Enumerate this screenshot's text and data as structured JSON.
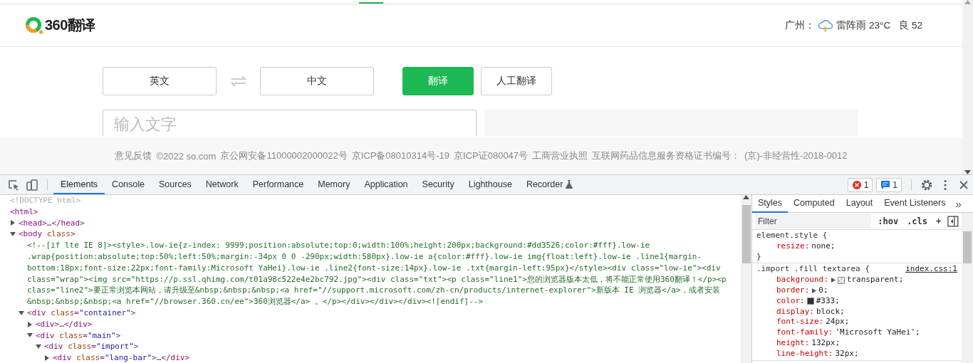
{
  "page": {
    "logo": {
      "text": "360翻译"
    },
    "weather": {
      "city": "广州：",
      "condition": "雷阵雨 23°C",
      "air_quality": "良 52"
    },
    "source_language": "英文",
    "target_language": "中文",
    "buttons": [
      {
        "label": "翻译",
        "kind": "primary"
      },
      {
        "label": "人工翻译",
        "kind": "secondary"
      }
    ],
    "input": {
      "placeholder": "输入文字"
    },
    "footer": [
      "意见反馈",
      "©2022 so.com",
      "京公网安备11000002000022号",
      "京ICP备08010314号-19",
      "京ICP证080047号",
      "工商营业执照",
      "互联网药品信息服务资格证书编号：",
      "(京)-非经营性-2018-0012"
    ]
  },
  "devtools": {
    "tabs": [
      {
        "label": "Elements",
        "selected": true,
        "kind": "plain"
      },
      {
        "label": "Console",
        "selected": false,
        "kind": "plain"
      },
      {
        "label": "Sources",
        "selected": false,
        "kind": "plain"
      },
      {
        "label": "Network",
        "selected": false,
        "kind": "plain"
      },
      {
        "label": "Performance",
        "selected": false,
        "kind": "plain"
      },
      {
        "label": "Memory",
        "selected": false,
        "kind": "plain"
      },
      {
        "label": "Application",
        "selected": false,
        "kind": "plain"
      },
      {
        "label": "Security",
        "selected": false,
        "kind": "plain"
      },
      {
        "label": "Lighthouse",
        "selected": false,
        "kind": "plain"
      },
      {
        "label": "Recorder",
        "selected": false,
        "kind": "experimental"
      }
    ],
    "badges": [
      {
        "kind": "error",
        "count": "1"
      },
      {
        "kind": "message",
        "count": "1"
      }
    ],
    "dom_tree": [
      {
        "kind": "doctype",
        "segments": [
          {
            "kind": "doctype",
            "text": "<!DOCTYPE html>"
          }
        ]
      },
      {
        "kind": "root",
        "segments": [
          {
            "kind": "tag",
            "text": "<html>"
          }
        ],
        "children": [
          {
            "kind": "node",
            "expanded": false,
            "segments": [
              {
                "kind": "tag",
                "text": "<head>"
              },
              {
                "kind": "text",
                "text": "…"
              },
              {
                "kind": "tag",
                "text": "</head>"
              }
            ]
          },
          {
            "kind": "node",
            "expanded": true,
            "segments": [
              {
                "kind": "tag",
                "text": "<body "
              },
              {
                "kind": "attr",
                "text": "class"
              },
              {
                "kind": "tag",
                "text": ">"
              }
            ],
            "children": [
              {
                "kind": "comment",
                "segments": [
                  {
                    "kind": "comment",
                    "text": "<!--[if lte IE 8]><style>.low-ie{z-index: 9999;position:absolute;top:0;width:100%;height:200px;background:#dd3526;color:#fff}.low-ie .wrap{position:absolute;top:50%;left:50%;margin:-34px 0 0 -290px;width:580px}.low-ie a{color:#fff}.low-ie img{float:left}.low-ie .line1{margin-bottom:18px;font-size:22px;font-family:Microsoft YaHei}.low-ie .line2{font-size:14px}.low-ie .txt{margin-left:95px}</style><div class=\"low-ie\"><div class=\"wrap\"><img src=\"https://p.ssl.qhimg.com/t01a98c522e4e2bc792.jpg\"><div class=\"txt\"><p class=\"line1\">您的浏览器版本太低，将不能正常使用360翻译！</p><p class=\"line2\">要正常浏览本网站，请升级至&nbsp;&nbsp;&nbsp;<a href=\"//support.microsoft.com/zh-cn/products/internet-explorer\">新版本 IE 浏览器</a>，或者安装&nbsp;&nbsp;&nbsp;<a href=\"//browser.360.cn/ee\">360浏览器</a> 。</p></div></div></div><![endif]-->"
                  }
                ]
              },
              {
                "kind": "node",
                "expanded": true,
                "segments": [
                  {
                    "kind": "tag",
                    "text": "<div "
                  },
                  {
                    "kind": "attr",
                    "text": "class"
                  },
                  {
                    "kind": "tag",
                    "text": "="
                  },
                  {
                    "kind": "value",
                    "text": "\"container\""
                  },
                  {
                    "kind": "tag",
                    "text": ">"
                  }
                ],
                "children": [
                  {
                    "kind": "node",
                    "expanded": false,
                    "segments": [
                      {
                        "kind": "tag",
                        "text": "<div>"
                      },
                      {
                        "kind": "text",
                        "text": "…"
                      },
                      {
                        "kind": "tag",
                        "text": "</div>"
                      }
                    ]
                  },
                  {
                    "kind": "node",
                    "expanded": true,
                    "segments": [
                      {
                        "kind": "tag",
                        "text": "<div "
                      },
                      {
                        "kind": "attr",
                        "text": "class"
                      },
                      {
                        "kind": "tag",
                        "text": "="
                      },
                      {
                        "kind": "value",
                        "text": "\"main\""
                      },
                      {
                        "kind": "tag",
                        "text": ">"
                      }
                    ],
                    "children": [
                      {
                        "kind": "node",
                        "expanded": true,
                        "segments": [
                          {
                            "kind": "tag",
                            "text": "<div "
                          },
                          {
                            "kind": "attr",
                            "text": "class"
                          },
                          {
                            "kind": "tag",
                            "text": "="
                          },
                          {
                            "kind": "value",
                            "text": "\"import\""
                          },
                          {
                            "kind": "tag",
                            "text": ">"
                          }
                        ],
                        "children": [
                          {
                            "kind": "node",
                            "expanded": false,
                            "segments": [
                              {
                                "kind": "tag",
                                "text": "<div "
                              },
                              {
                                "kind": "attr",
                                "text": "class"
                              },
                              {
                                "kind": "tag",
                                "text": "="
                              },
                              {
                                "kind": "value",
                                "text": "\"lang-bar\""
                              },
                              {
                                "kind": "tag",
                                "text": ">"
                              },
                              {
                                "kind": "text",
                                "text": "…"
                              },
                              {
                                "kind": "tag",
                                "text": "</div>"
                              }
                            ]
                          }
                        ]
                      }
                    ]
                  }
                ]
              }
            ]
          }
        ]
      }
    ],
    "styles_tabs": [
      {
        "label": "Styles",
        "selected": true
      },
      {
        "label": "Computed",
        "selected": false
      },
      {
        "label": "Layout",
        "selected": false
      },
      {
        "label": "Event Listeners",
        "selected": false
      }
    ],
    "more": "»",
    "filter": {
      "placeholder": "Filter"
    },
    "filter_buttons": [
      ":hov",
      ".cls",
      "+"
    ],
    "rules": [
      {
        "selector": "element.style {",
        "close": "}",
        "declarations": [
          {
            "property": "resize:",
            "value": "none;",
            "kind": "plain"
          }
        ]
      },
      {
        "selector": ".import .fill textarea {",
        "source": "index.css:1",
        "declarations": [
          {
            "property": "background:",
            "value": "transparent;",
            "kind": "transparent"
          },
          {
            "property": "border:",
            "value": "0;",
            "kind": "expandable"
          },
          {
            "property": "color:",
            "value": "#333;",
            "kind": "color",
            "color": "#333333"
          },
          {
            "property": "display:",
            "value": "block;",
            "kind": "plain"
          },
          {
            "property": "font-size:",
            "value": "24px;",
            "kind": "plain"
          },
          {
            "property": "font-family:",
            "value": "'Microsoft YaHei';",
            "kind": "plain"
          },
          {
            "property": "height:",
            "value": "132px;",
            "kind": "plain"
          },
          {
            "property": "line-height:",
            "value": "32px;",
            "kind": "plain"
          }
        ]
      }
    ]
  }
}
